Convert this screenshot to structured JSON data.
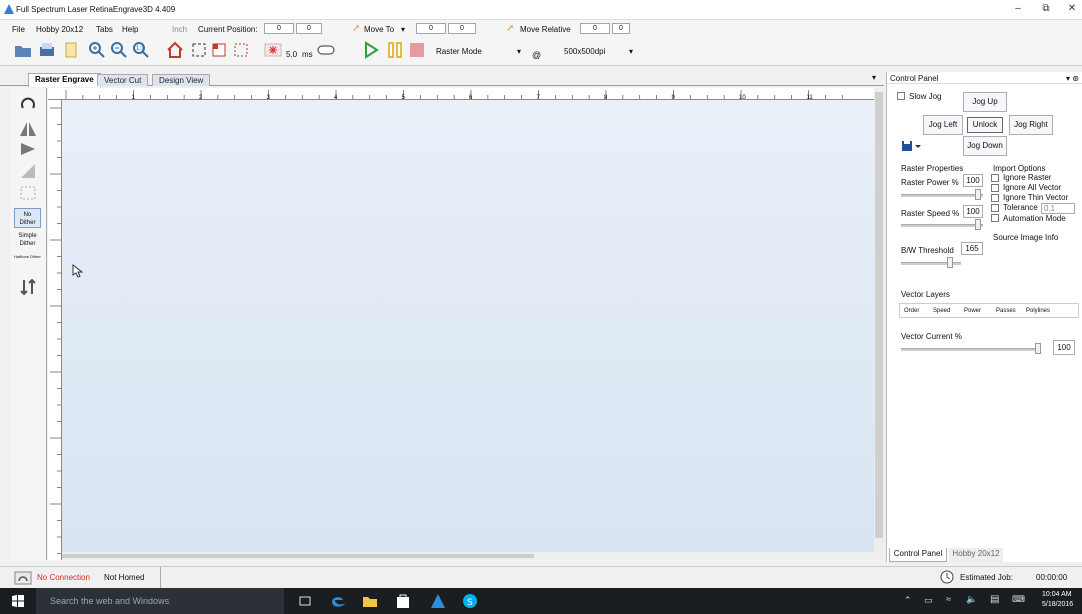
{
  "window": {
    "title": "Full Spectrum Laser RetinaEngrave3D 4.409"
  },
  "menu": [
    "File",
    "Hobby 20x12",
    "Tabs",
    "Help"
  ],
  "position": {
    "units": "Inch",
    "current_label": "Current Position:",
    "current_x": "0",
    "current_y": "0",
    "moveto_label": "Move To",
    "moveto_x": "0",
    "moveto_y": "0",
    "moverel_label": "Move Relative",
    "moverel_x": "0",
    "moverel_y": "0"
  },
  "toolbar": {
    "pulse_value": "5.0",
    "pulse_unit": "ms",
    "mode": "Raster Mode",
    "at": "@",
    "dpi": "500x500dpi"
  },
  "tabs": [
    "Raster Engrave",
    "Vector Cut",
    "Design View"
  ],
  "left_tools": {
    "no_dither": "No Dither",
    "simple_dither": "Simple Dither",
    "halftone_dither": "Halftone Dither"
  },
  "ruler": {
    "ticks": [
      "1",
      "2",
      "3",
      "4",
      "5",
      "6",
      "7",
      "8",
      "9",
      "10",
      "11"
    ]
  },
  "control_panel": {
    "title": "Control Panel",
    "slow_jog": "Slow Jog",
    "jog_up": "Jog Up",
    "jog_left": "Jog Left",
    "unlock": "Unlock",
    "jog_right": "Jog Right",
    "jog_down": "Jog Down",
    "raster_props": "Raster Properties",
    "raster_power_label": "Raster Power %",
    "raster_power": "100",
    "raster_speed_label": "Raster Speed %",
    "raster_speed": "100",
    "bw_label": "B/W Threshold",
    "bw_value": "165",
    "import_options": "Import Options",
    "ignore_raster": "Ignore Raster",
    "ignore_all_vector": "Ignore All Vector",
    "ignore_thin_vector": "Ignore Thin Vector",
    "tolerance_label": "Tolerance",
    "tolerance": "0.1",
    "automation_mode": "Automation Mode",
    "source_image": "Source Image Info",
    "vector_layers": "Vector Layers",
    "vl_cols": [
      "Order",
      "Speed",
      "Power",
      "Passes",
      "Polylines"
    ],
    "vector_current_label": "Vector Current %",
    "vector_current": "100",
    "bottom_tabs": [
      "Control Panel",
      "Hobby 20x12"
    ]
  },
  "status": {
    "connection": "No Connection",
    "homed": "Not Homed",
    "est_label": "Estimated Job:",
    "est_time": "00:00:00"
  },
  "taskbar": {
    "search": "Search the web and Windows",
    "time": "10:04 AM",
    "date": "5/18/2016"
  }
}
